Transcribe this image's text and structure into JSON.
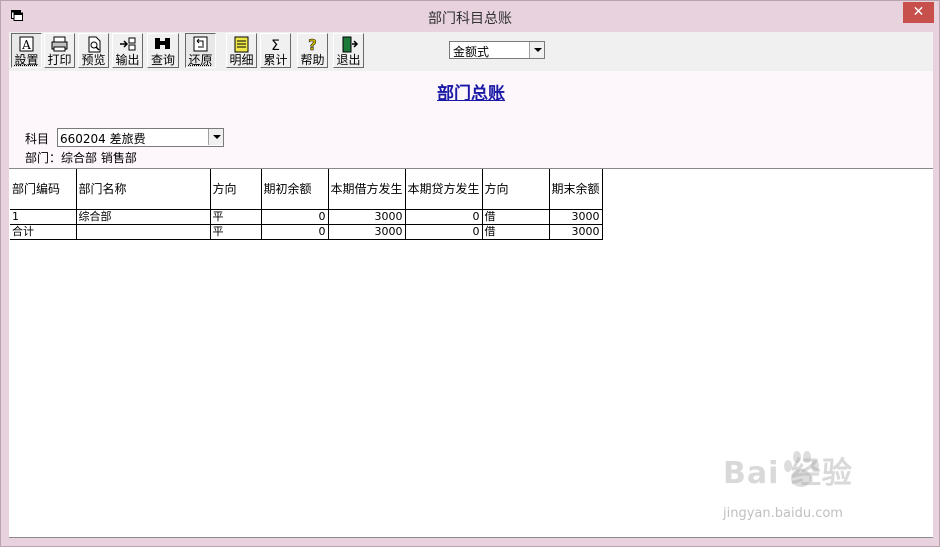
{
  "window": {
    "title": "部门科目总账",
    "close_label": "✕"
  },
  "toolbar": {
    "buttons": [
      {
        "label": "設置",
        "icon": "settings-icon"
      },
      {
        "label": "打印",
        "icon": "printer-icon"
      },
      {
        "label": "预览",
        "icon": "preview-icon"
      },
      {
        "label": "输出",
        "icon": "export-icon"
      },
      {
        "label": "查询",
        "icon": "binoculars-icon"
      },
      {
        "label": "还原",
        "icon": "restore-icon"
      },
      {
        "label": "明细",
        "icon": "detail-icon"
      },
      {
        "label": "累计",
        "icon": "sigma-icon"
      },
      {
        "label": "帮助",
        "icon": "help-icon"
      },
      {
        "label": "退出",
        "icon": "exit-icon"
      }
    ],
    "format_select": {
      "value": "金额式"
    }
  },
  "report": {
    "title": "部门总账",
    "subject_label": "科目",
    "subject_value": "660204 差旅费",
    "department_line": "部门：综合部 销售部"
  },
  "grid": {
    "columns": [
      "部门编码",
      "部门名称",
      "方向",
      "期初余额",
      "本期借方发生",
      "本期贷方发生",
      "方向",
      "期末余额"
    ],
    "rows": [
      [
        "1",
        "综合部",
        "平",
        "0",
        "3000",
        "0",
        "借",
        "3000"
      ],
      [
        "合计",
        "",
        "平",
        "0",
        "3000",
        "0",
        "借",
        "3000"
      ]
    ]
  },
  "watermark": {
    "brand": "Bai  经验",
    "url": "jingyan.baidu.com"
  },
  "colors": {
    "title_blue": "#1a1aa6",
    "window_frame": "#e7d2de",
    "close_red": "#c7504c"
  }
}
